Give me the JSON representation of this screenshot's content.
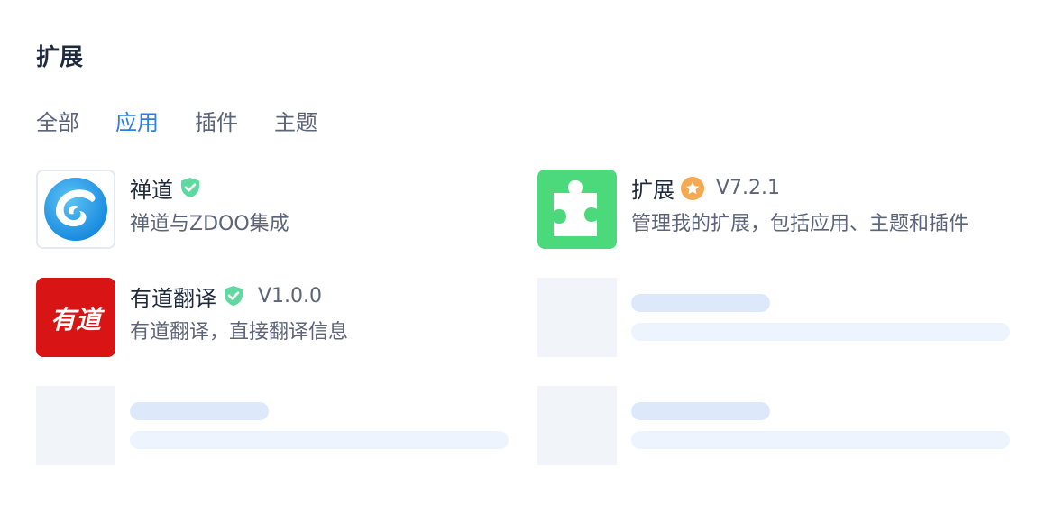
{
  "header": {
    "title": "扩展"
  },
  "tabs": [
    {
      "label": "全部",
      "active": false
    },
    {
      "label": "应用",
      "active": true
    },
    {
      "label": "插件",
      "active": false
    },
    {
      "label": "主题",
      "active": false
    }
  ],
  "extensions": [
    {
      "name": "禅道",
      "badge": "verified-shield-icon",
      "version": "",
      "description": "禅道与ZDOO集成",
      "logo": "zentao-logo"
    },
    {
      "name": "扩展",
      "badge": "star-badge-icon",
      "version": "V7.2.1",
      "description": "管理我的扩展，包括应用、主题和插件",
      "logo": "puzzle-piece-icon"
    },
    {
      "name": "有道翻译",
      "badge": "verified-shield-icon",
      "version": "V1.0.0",
      "description": "有道翻译，直接翻译信息",
      "logo": "youdao-logo",
      "logo_text": "有道"
    }
  ],
  "colors": {
    "accent": "#2f7ee6",
    "verified": "#5fd9a0",
    "star_badge": "#f5a952",
    "puzzle_bg": "#4cd97b",
    "youdao_bg": "#d81414"
  }
}
